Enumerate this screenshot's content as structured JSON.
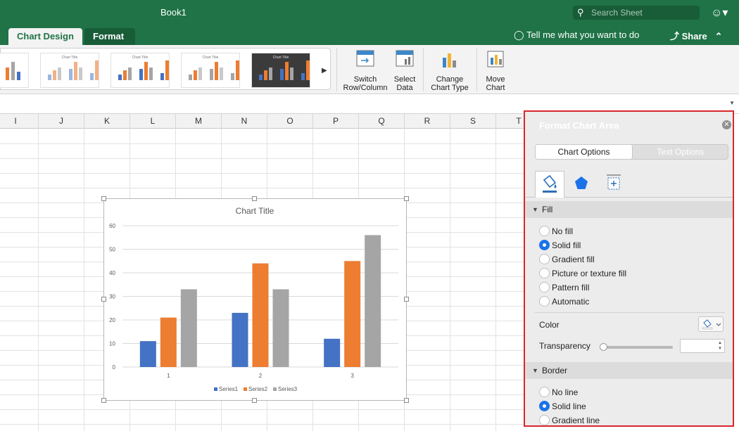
{
  "window": {
    "title": "Book1"
  },
  "search": {
    "placeholder": "Search Sheet"
  },
  "ribbon": {
    "tabs": [
      {
        "label": "Chart Design"
      },
      {
        "label": "Format"
      }
    ],
    "tell_me": "Tell me what you want to do",
    "share": "Share",
    "gallery_thumb_title": "Chart Title",
    "buttons": {
      "switch_row_col": [
        "Switch",
        "Row/Column"
      ],
      "select_data": [
        "Select",
        "Data"
      ],
      "change_chart_type": [
        "Change",
        "Chart Type"
      ],
      "move_chart": [
        "Move",
        "Chart"
      ]
    }
  },
  "sheet": {
    "columns": [
      "I",
      "J",
      "K",
      "L",
      "M",
      "N",
      "O",
      "P",
      "Q",
      "R",
      "S",
      "T"
    ]
  },
  "chart_data": {
    "type": "bar",
    "title": "Chart Title",
    "categories": [
      "1",
      "2",
      "3"
    ],
    "series": [
      {
        "name": "Series1",
        "values": [
          11,
          23,
          12
        ],
        "color": "#4472c4"
      },
      {
        "name": "Series2",
        "values": [
          21,
          44,
          45
        ],
        "color": "#ed7d31"
      },
      {
        "name": "Series3",
        "values": [
          33,
          33,
          56
        ],
        "color": "#a5a5a5"
      }
    ],
    "ylim": [
      0,
      60
    ],
    "yticks": [
      "0",
      "10",
      "20",
      "30",
      "40",
      "50",
      "60"
    ],
    "grid": true,
    "legend": "bottom"
  },
  "pane": {
    "title": "Format Chart Area",
    "tabs": {
      "chart_options": "Chart Options",
      "text_options": "Text Options"
    },
    "fill": {
      "header": "Fill",
      "options": [
        {
          "label": "No fill",
          "selected": false
        },
        {
          "label": "Solid fill",
          "selected": true
        },
        {
          "label": "Gradient fill",
          "selected": false
        },
        {
          "label": "Picture or texture fill",
          "selected": false
        },
        {
          "label": "Pattern fill",
          "selected": false
        },
        {
          "label": "Automatic",
          "selected": false
        }
      ],
      "color_label": "Color",
      "transparency_label": "Transparency"
    },
    "border": {
      "header": "Border",
      "options": [
        {
          "label": "No line",
          "selected": false
        },
        {
          "label": "Solid line",
          "selected": true
        },
        {
          "label": "Gradient line",
          "selected": false
        }
      ]
    }
  },
  "colors": {
    "accent_green": "#1f7346",
    "highlight_red": "#d8262d",
    "radio_blue": "#1a73e8"
  }
}
